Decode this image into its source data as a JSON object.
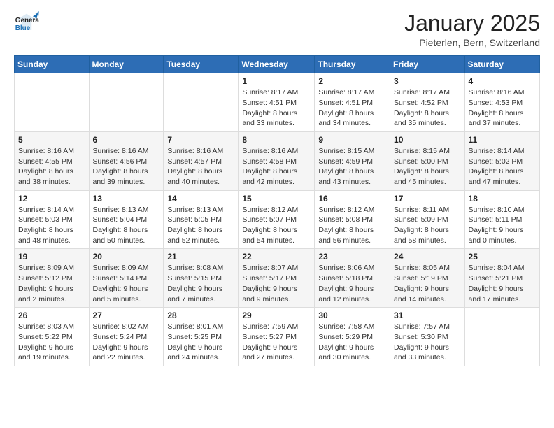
{
  "header": {
    "logo_general": "General",
    "logo_blue": "Blue",
    "month_title": "January 2025",
    "location": "Pieterlen, Bern, Switzerland"
  },
  "days_of_week": [
    "Sunday",
    "Monday",
    "Tuesday",
    "Wednesday",
    "Thursday",
    "Friday",
    "Saturday"
  ],
  "weeks": [
    [
      {
        "day": "",
        "info": ""
      },
      {
        "day": "",
        "info": ""
      },
      {
        "day": "",
        "info": ""
      },
      {
        "day": "1",
        "sunrise": "8:17 AM",
        "sunset": "4:51 PM",
        "daylight": "8 hours and 33 minutes."
      },
      {
        "day": "2",
        "sunrise": "8:17 AM",
        "sunset": "4:51 PM",
        "daylight": "8 hours and 34 minutes."
      },
      {
        "day": "3",
        "sunrise": "8:17 AM",
        "sunset": "4:52 PM",
        "daylight": "8 hours and 35 minutes."
      },
      {
        "day": "4",
        "sunrise": "8:16 AM",
        "sunset": "4:53 PM",
        "daylight": "8 hours and 37 minutes."
      }
    ],
    [
      {
        "day": "5",
        "sunrise": "8:16 AM",
        "sunset": "4:55 PM",
        "daylight": "8 hours and 38 minutes."
      },
      {
        "day": "6",
        "sunrise": "8:16 AM",
        "sunset": "4:56 PM",
        "daylight": "8 hours and 39 minutes."
      },
      {
        "day": "7",
        "sunrise": "8:16 AM",
        "sunset": "4:57 PM",
        "daylight": "8 hours and 40 minutes."
      },
      {
        "day": "8",
        "sunrise": "8:16 AM",
        "sunset": "4:58 PM",
        "daylight": "8 hours and 42 minutes."
      },
      {
        "day": "9",
        "sunrise": "8:15 AM",
        "sunset": "4:59 PM",
        "daylight": "8 hours and 43 minutes."
      },
      {
        "day": "10",
        "sunrise": "8:15 AM",
        "sunset": "5:00 PM",
        "daylight": "8 hours and 45 minutes."
      },
      {
        "day": "11",
        "sunrise": "8:14 AM",
        "sunset": "5:02 PM",
        "daylight": "8 hours and 47 minutes."
      }
    ],
    [
      {
        "day": "12",
        "sunrise": "8:14 AM",
        "sunset": "5:03 PM",
        "daylight": "8 hours and 48 minutes."
      },
      {
        "day": "13",
        "sunrise": "8:13 AM",
        "sunset": "5:04 PM",
        "daylight": "8 hours and 50 minutes."
      },
      {
        "day": "14",
        "sunrise": "8:13 AM",
        "sunset": "5:05 PM",
        "daylight": "8 hours and 52 minutes."
      },
      {
        "day": "15",
        "sunrise": "8:12 AM",
        "sunset": "5:07 PM",
        "daylight": "8 hours and 54 minutes."
      },
      {
        "day": "16",
        "sunrise": "8:12 AM",
        "sunset": "5:08 PM",
        "daylight": "8 hours and 56 minutes."
      },
      {
        "day": "17",
        "sunrise": "8:11 AM",
        "sunset": "5:09 PM",
        "daylight": "8 hours and 58 minutes."
      },
      {
        "day": "18",
        "sunrise": "8:10 AM",
        "sunset": "5:11 PM",
        "daylight": "9 hours and 0 minutes."
      }
    ],
    [
      {
        "day": "19",
        "sunrise": "8:09 AM",
        "sunset": "5:12 PM",
        "daylight": "9 hours and 2 minutes."
      },
      {
        "day": "20",
        "sunrise": "8:09 AM",
        "sunset": "5:14 PM",
        "daylight": "9 hours and 5 minutes."
      },
      {
        "day": "21",
        "sunrise": "8:08 AM",
        "sunset": "5:15 PM",
        "daylight": "9 hours and 7 minutes."
      },
      {
        "day": "22",
        "sunrise": "8:07 AM",
        "sunset": "5:17 PM",
        "daylight": "9 hours and 9 minutes."
      },
      {
        "day": "23",
        "sunrise": "8:06 AM",
        "sunset": "5:18 PM",
        "daylight": "9 hours and 12 minutes."
      },
      {
        "day": "24",
        "sunrise": "8:05 AM",
        "sunset": "5:19 PM",
        "daylight": "9 hours and 14 minutes."
      },
      {
        "day": "25",
        "sunrise": "8:04 AM",
        "sunset": "5:21 PM",
        "daylight": "9 hours and 17 minutes."
      }
    ],
    [
      {
        "day": "26",
        "sunrise": "8:03 AM",
        "sunset": "5:22 PM",
        "daylight": "9 hours and 19 minutes."
      },
      {
        "day": "27",
        "sunrise": "8:02 AM",
        "sunset": "5:24 PM",
        "daylight": "9 hours and 22 minutes."
      },
      {
        "day": "28",
        "sunrise": "8:01 AM",
        "sunset": "5:25 PM",
        "daylight": "9 hours and 24 minutes."
      },
      {
        "day": "29",
        "sunrise": "7:59 AM",
        "sunset": "5:27 PM",
        "daylight": "9 hours and 27 minutes."
      },
      {
        "day": "30",
        "sunrise": "7:58 AM",
        "sunset": "5:29 PM",
        "daylight": "9 hours and 30 minutes."
      },
      {
        "day": "31",
        "sunrise": "7:57 AM",
        "sunset": "5:30 PM",
        "daylight": "9 hours and 33 minutes."
      },
      {
        "day": "",
        "info": ""
      }
    ]
  ],
  "labels": {
    "sunrise": "Sunrise:",
    "sunset": "Sunset:",
    "daylight": "Daylight:"
  }
}
